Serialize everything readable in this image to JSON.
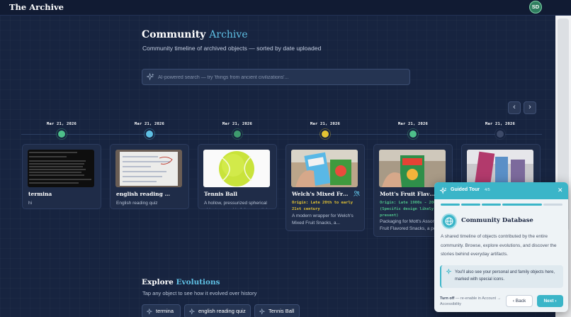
{
  "header": {
    "logo": "The Archive",
    "avatar_initials": "SD"
  },
  "hero": {
    "title_main": "Community",
    "title_accent": "Archive",
    "subtitle": "Community timeline of archived objects — sorted by date uploaded"
  },
  "search": {
    "placeholder": "AI-powered search — try 'things from ancient civilizations'..."
  },
  "nav": {
    "prev": "‹",
    "next": "›"
  },
  "timeline": {
    "items": [
      {
        "date": "Mar 21, 2026",
        "dot_color": "#4ec08a",
        "title": "termina",
        "desc": "hi"
      },
      {
        "date": "Mar 21, 2026",
        "dot_color": "#5fc0e4",
        "title": "english reading quiz",
        "desc": "English reading quiz"
      },
      {
        "date": "Mar 21, 2026",
        "dot_color": "#3e9a6e",
        "title": "Tennis Ball",
        "desc": "A hollow, pressurized spherical object covered in felt, essential..."
      },
      {
        "date": "Mar 21, 2026",
        "dot_color": "#e4c433",
        "title": "Welch's Mixed Fruit ...",
        "origin": "Origin: Late 20th to early 21st century",
        "desc": "A modern wrapper for Welch's Mixed Fruit Snacks, a..."
      },
      {
        "date": "Mar 21, 2026",
        "dot_color": "#4ec08a",
        "title": "Mott's Fruit Flavored ...",
        "origin": "Origin: Late 1900s - 2000s (Specific design likely 2010s-present)",
        "desc": "Packaging for Mott's Assorted Fruit Flavored Snacks, a pop..."
      },
      {
        "date": "Mar 21, 2026",
        "dot_color": "#3d4a68"
      }
    ]
  },
  "explore": {
    "title_main": "Explore",
    "title_accent": "Evolutions",
    "subtitle": "Tap any object to see how it evolved over history",
    "chips": [
      "termina",
      "english reading quiz",
      "Tennis Ball"
    ]
  },
  "tour": {
    "label": "Guided Tour",
    "step": "4/5",
    "close": "✕",
    "title": "Community Database",
    "body": "A shared timeline of objects contributed by the entire community. Browse, explore evolutions, and discover the stories behind everyday artifacts.",
    "note": "You'll also see your personal and family objects here, marked with special icons.",
    "turnoff_label": "Turn off",
    "turnoff_hint": "— re-enable in Account → Accessibility",
    "back_label": "Back",
    "next_label": "Next"
  },
  "colors": {
    "accent": "#5fc0e4",
    "tour": "#3bb5c8",
    "background": "#172440"
  }
}
